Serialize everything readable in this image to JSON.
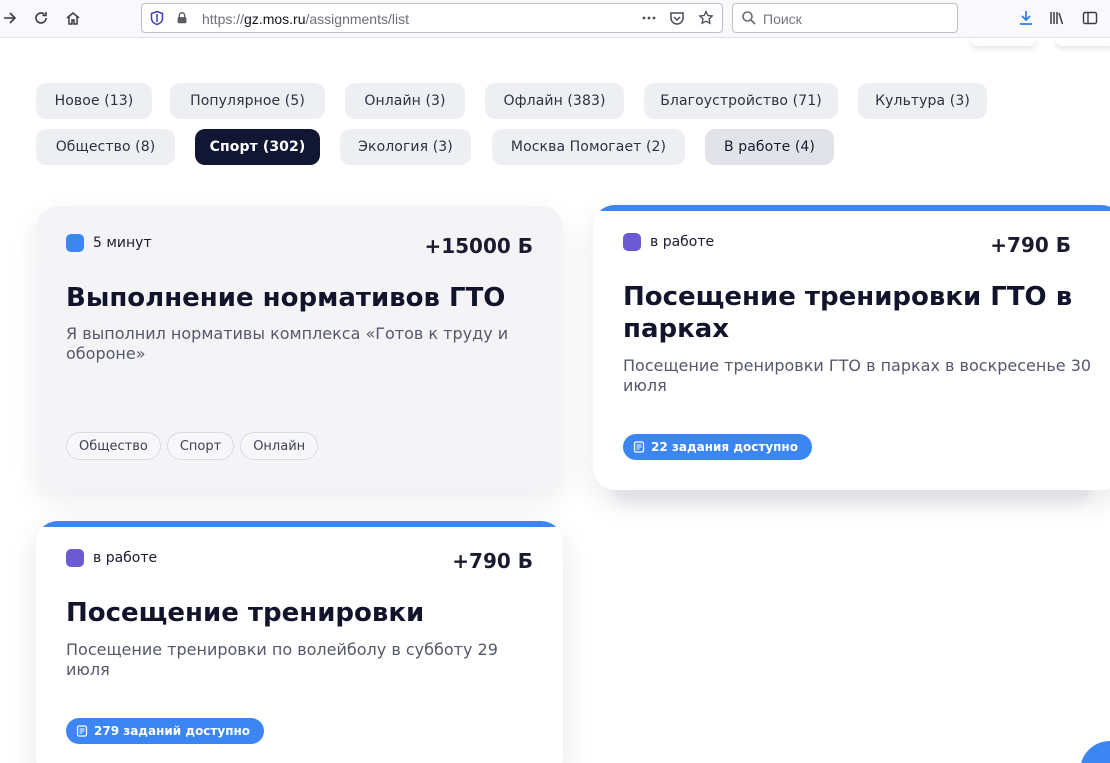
{
  "browser": {
    "url_prefix": "https://",
    "url_host": "gz.mos.ru",
    "url_path": "/assignments/list",
    "search_placeholder": "Поиск"
  },
  "categories": [
    {
      "label": "Новое (13)"
    },
    {
      "label": "Популярное (5)"
    },
    {
      "label": "Онлайн (3)"
    },
    {
      "label": "Офлайн (383)"
    },
    {
      "label": "Благоустройство (71)"
    },
    {
      "label": "Культура (3)"
    },
    {
      "label": "Общество (8)"
    },
    {
      "label": "Спорт (302)"
    },
    {
      "label": "Экология (3)"
    },
    {
      "label": "Москва Помогает (2)"
    },
    {
      "label": "В работе (4)"
    }
  ],
  "cards": [
    {
      "status": "5 минут",
      "status_color": "#3b86f2",
      "points": "+15000 Б",
      "title": "Выполнение нормативов ГТО",
      "description": "Я выполнил нормативы комплекса «Готов к труду и обороне»",
      "tags": [
        "Общество",
        "Спорт",
        "Онлайн"
      ]
    },
    {
      "status": "в работе",
      "status_color": "#6a5bd2",
      "points": "+790 Б",
      "title": "Посещение тренировки ГТО в парках",
      "description": "Посещение тренировки ГТО в парках в воскресенье 30 июля",
      "available": "22 задания доступно"
    },
    {
      "status": "в работе",
      "status_color": "#6a5bd2",
      "points": "+790 Б",
      "title": "Посещение тренировки",
      "description": "Посещение тренировки по волейболу в субботу 29 июля",
      "available": "279 заданий доступно"
    }
  ],
  "colors": {
    "accent": "#3b86f2",
    "active_chip": "#111633",
    "in_progress": "#6a5bd2"
  }
}
